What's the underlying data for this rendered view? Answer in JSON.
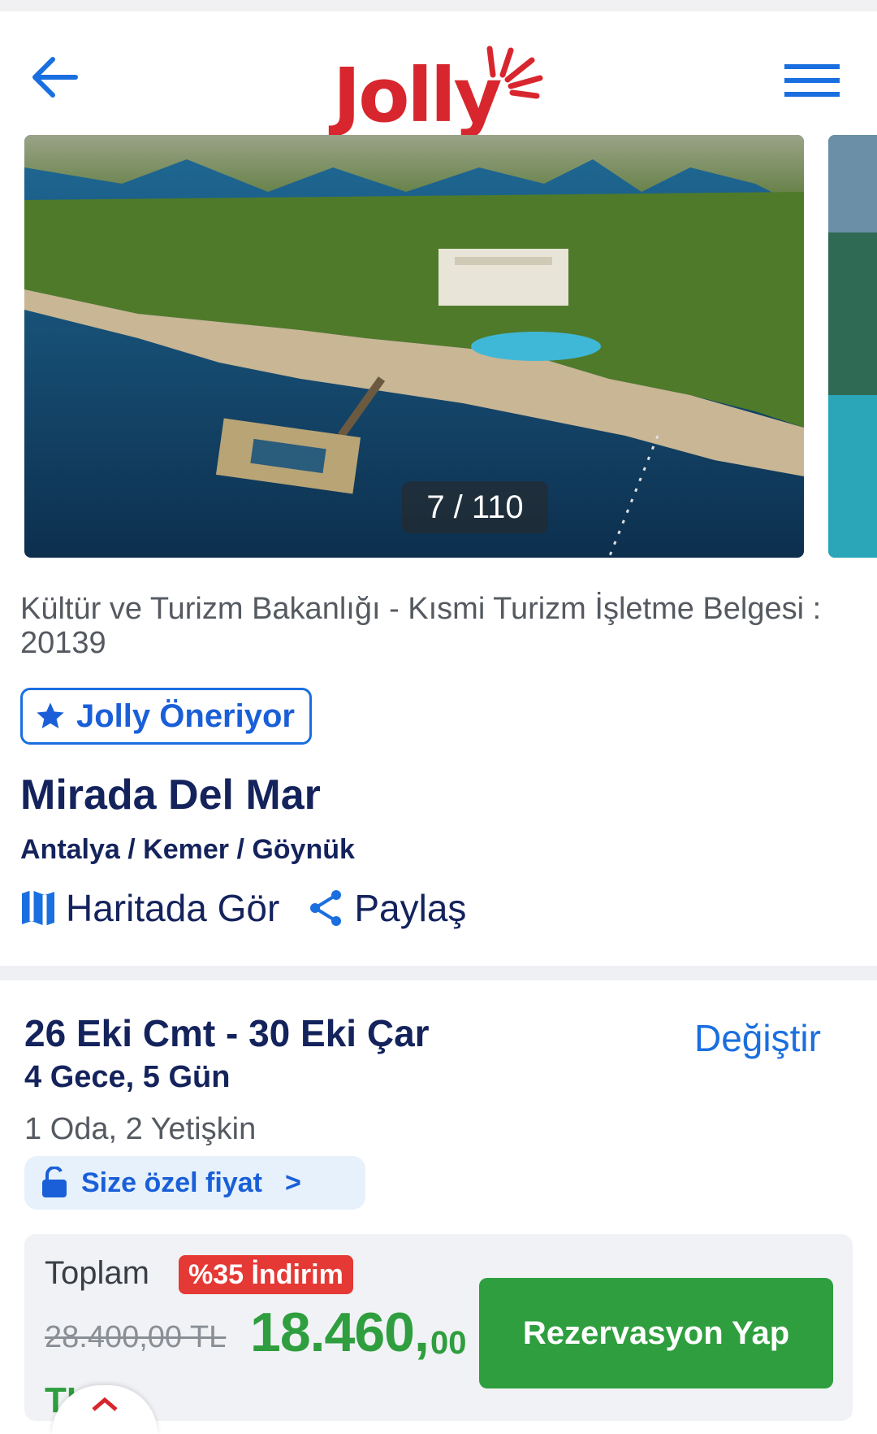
{
  "header": {
    "logo_text": "Jolly",
    "back_icon": "arrow-left-icon",
    "menu_icon": "hamburger-menu-icon"
  },
  "gallery": {
    "counter": "7 / 110"
  },
  "hotel": {
    "license": "Kültür ve Turizm Bakanlığı - Kısmi Turizm İşletme Belgesi : 20139",
    "recommend_label": "Jolly Öneriyor",
    "name": "Mirada Del Mar",
    "location": "Antalya / Kemer / Göynük",
    "map_label": "Haritada Gör",
    "share_label": "Paylaş"
  },
  "booking": {
    "dates": "26 Eki Cmt - 30 Eki Çar",
    "change_label": "Değiştir",
    "nights": "4 Gece, 5 Gün",
    "guests": "1 Oda, 2 Yetişkin",
    "special_price": "Size özel fiyat",
    "special_price_chevron": ">"
  },
  "price": {
    "total_label": "Toplam",
    "discount": "%35 İndirim",
    "old_price": "28.400,00 TL",
    "new_price_main": "18.460,",
    "new_price_decimal": "00",
    "currency": "TL",
    "reserve_label": "Rezervasyon Yap"
  },
  "colors": {
    "brand_red": "#d8262e",
    "primary_blue": "#1a6fe0",
    "navy": "#14235c",
    "green": "#2e9e3e",
    "discount_red": "#e53935"
  }
}
